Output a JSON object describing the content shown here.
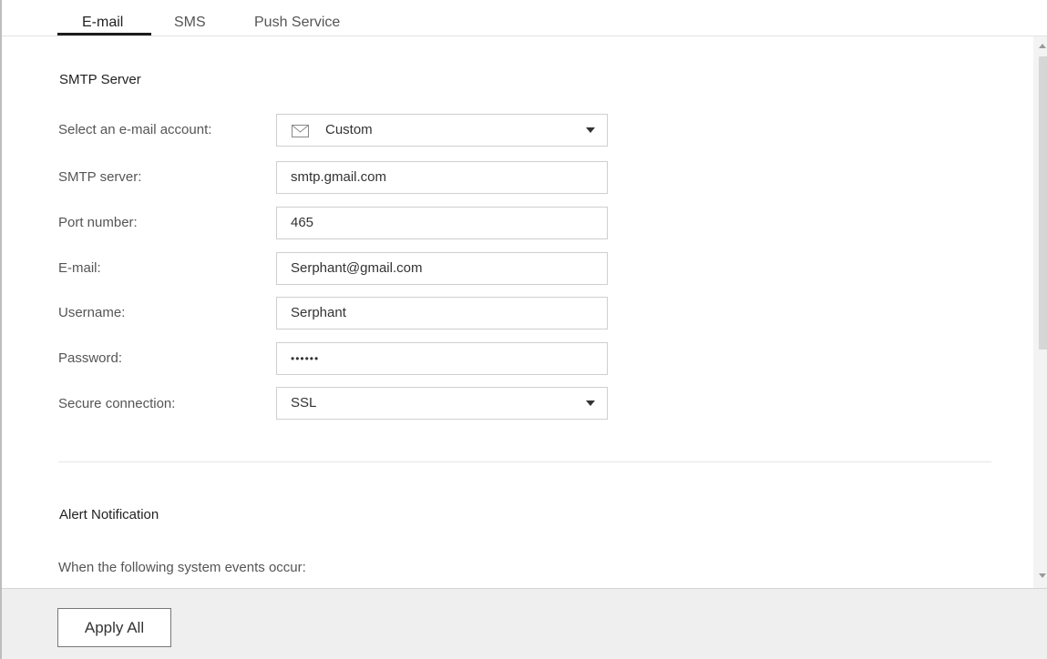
{
  "tabs": [
    {
      "label": "E-mail",
      "active": true
    },
    {
      "label": "SMS",
      "active": false
    },
    {
      "label": "Push Service",
      "active": false
    }
  ],
  "smtp": {
    "title": "SMTP Server",
    "fields": {
      "account": {
        "label": "Select an e-mail account:",
        "value": "Custom",
        "icon": "mail-icon"
      },
      "server": {
        "label": "SMTP server:",
        "value": "smtp.gmail.com"
      },
      "port": {
        "label": "Port number:",
        "value": "465"
      },
      "email": {
        "label": "E-mail:",
        "value": "Serphant@gmail.com"
      },
      "username": {
        "label": "Username:",
        "value": "Serphant"
      },
      "password": {
        "label": "Password:",
        "value": "••••••"
      },
      "secure": {
        "label": "Secure connection:",
        "value": "SSL"
      }
    }
  },
  "alert": {
    "title": "Alert Notification",
    "description": "When the following system events occur:"
  },
  "footer": {
    "apply_label": "Apply All"
  },
  "colors": {
    "tab_underline": "#1d1d1d",
    "footer_bg": "#efefef",
    "input_border": "#cfcfcf"
  }
}
